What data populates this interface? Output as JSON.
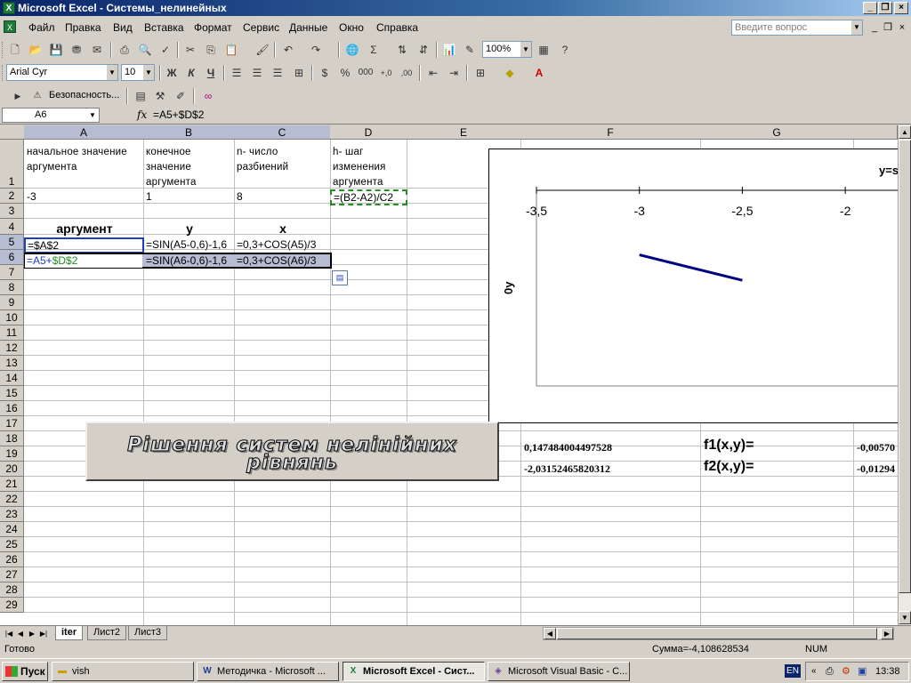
{
  "window": {
    "title": "Microsoft Excel - Системы_нелинейных"
  },
  "menu": {
    "items": [
      "Файл",
      "Правка",
      "Вид",
      "Вставка",
      "Формат",
      "Сервис",
      "Данные",
      "Окно",
      "Справка"
    ],
    "help_placeholder": "Введите вопрос"
  },
  "toolbar": {
    "zoom": "100%",
    "font": "Arial Cyr",
    "font_size": "10",
    "security_label": "Безопасность...",
    "bold": "Ж",
    "italic": "К",
    "underline": "Ч",
    "percent": "%",
    "thousands": "000"
  },
  "formula_bar": {
    "name_box": "A6",
    "fx": "fx",
    "formula": "=A5+$D$2"
  },
  "columns": [
    "A",
    "B",
    "C",
    "D",
    "E",
    "F",
    "G"
  ],
  "rows": [
    "1",
    "2",
    "3",
    "4",
    "5",
    "6",
    "7",
    "8",
    "9",
    "10",
    "11",
    "12",
    "13",
    "14",
    "15",
    "16",
    "17",
    "18",
    "19",
    "20",
    "21",
    "22",
    "23",
    "24",
    "25",
    "26",
    "27",
    "28",
    "29"
  ],
  "cells": {
    "A1": "начальное значение аргумента",
    "B1": "конечное значение аргумента",
    "C1": "n- число разбиений",
    "D1": "h- шаг изменения аргумента",
    "A2": "-3",
    "B2": "1",
    "C2": "8",
    "D2": "=(B2-A2)/C2",
    "A4": "аргумент",
    "B4": "y",
    "C4": "x",
    "A5": "=$A$2",
    "B5": "=SIN(A5-0,6)-1,6",
    "C5": "=0,3+COS(A5)/3",
    "A6": "=A5+$D$2",
    "B6": "=SIN(A6-0,6)-1,6",
    "C6": "=0,3+COS(A6)/3",
    "F18": "0,147484004497528",
    "G18": "f1(x,y)=",
    "H18": "-0,00570",
    "F19": "-2,03152465820312",
    "G19": "f2(x,y)=",
    "H19": "-0,01294"
  },
  "chart_data": {
    "type": "line",
    "title": "y=s",
    "ylabel": "0y",
    "x_ticks": [
      "-3,5",
      "-3",
      "-2,5",
      "-2"
    ],
    "xlim": [
      -3.5,
      -1.75
    ],
    "series": [
      {
        "x": [
          -3.0,
          -2.5
        ],
        "y_frac_from_top": [
          0.33,
          0.46
        ],
        "color": "#000080"
      }
    ]
  },
  "wordart": {
    "line1": "Рішення систем нелінійних",
    "line2": "рівнянь"
  },
  "sheets": {
    "tabs": [
      "iter",
      "Лист2",
      "Лист3"
    ],
    "active": "iter"
  },
  "status": {
    "left": "Готово",
    "sum": "Сумма=-4,108628534",
    "num": "NUM"
  },
  "taskbar": {
    "start": "Пуск",
    "buttons": [
      "vish",
      "Методичка - Microsoft ...",
      "Microsoft Excel - Сист...",
      "Microsoft Visual Basic - C..."
    ],
    "lang": "EN",
    "clock": "13:38"
  }
}
